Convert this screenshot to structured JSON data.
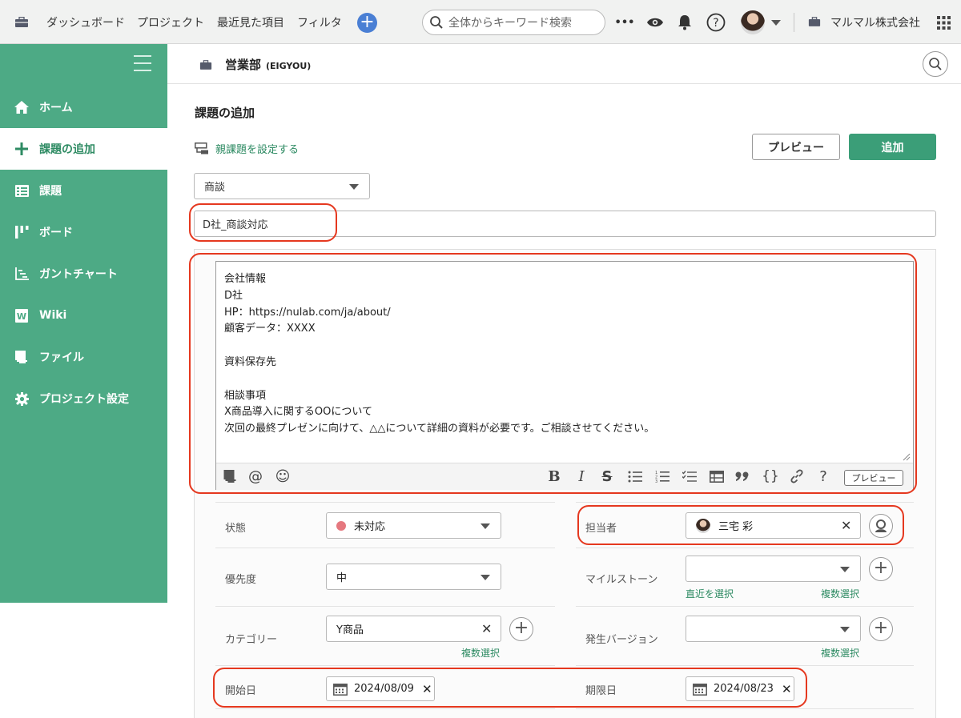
{
  "topbar": {
    "nav": [
      "ダッシュボード",
      "プロジェクト",
      "最近見た項目",
      "フィルタ"
    ],
    "add_label": "+",
    "search_placeholder": "全体からキーワード検索",
    "more_label": "•••",
    "org_name": "マルマル株式会社",
    "icons": [
      "briefcase-icon",
      "search-icon",
      "eye-icon",
      "bell-icon",
      "help-icon",
      "grid-icon"
    ]
  },
  "sidebar": {
    "items": [
      {
        "label": "ホーム",
        "icon": "home-icon"
      },
      {
        "label": "課題の追加",
        "icon": "plus-icon"
      },
      {
        "label": "課題",
        "icon": "list-icon"
      },
      {
        "label": "ボード",
        "icon": "board-icon"
      },
      {
        "label": "ガントチャート",
        "icon": "gantt-icon"
      },
      {
        "label": "Wiki",
        "icon": "wiki-icon"
      },
      {
        "label": "ファイル",
        "icon": "folder-icon"
      },
      {
        "label": "プロジェクト設定",
        "icon": "gear-icon"
      }
    ],
    "active_index": 1
  },
  "project": {
    "name": "営業部",
    "key": "(EIGYOU)"
  },
  "form": {
    "title": "課題の追加",
    "parent_link": "親課題を設定する",
    "preview_button": "プレビュー",
    "add_button": "追加",
    "issue_type": "商談",
    "subject": "D社_商談対応",
    "description_lines": [
      "会社情報",
      "D社",
      "HP：https://nulab.com/ja/about/",
      "顧客データ：XXXX",
      "",
      "資料保存先",
      "",
      "相談事項",
      "X商品導入に関するOOについて",
      "次回の最終プレゼンに向けて、△△について詳細の資料が必要です。ご相談させてください。"
    ],
    "toolbar": {
      "left": [
        "@",
        "☺"
      ],
      "right": [
        "B",
        "I",
        "S"
      ],
      "help": "?",
      "preview": "プレビュー"
    },
    "fields": {
      "status": {
        "label": "状態",
        "value": "未対応",
        "color": "#e5787f"
      },
      "assignee": {
        "label": "担当者",
        "value": "三宅 彩"
      },
      "priority": {
        "label": "優先度",
        "value": "中"
      },
      "milestone": {
        "label": "マイルストーン",
        "value": "",
        "link_recent": "直近を選択",
        "link_multi": "複数選択"
      },
      "category": {
        "label": "カテゴリー",
        "value": "Y商品",
        "link_multi": "複数選択"
      },
      "version": {
        "label": "発生バージョン",
        "value": "",
        "link_multi": "複数選択"
      },
      "start_date": {
        "label": "開始日",
        "value": "2024/08/09"
      },
      "due_date": {
        "label": "期限日",
        "value": "2024/08/23"
      }
    }
  },
  "colors": {
    "accent": "#4daa85",
    "primary_button": "#3b9e78",
    "highlight": "#e5381f",
    "link": "#2e8b63"
  }
}
